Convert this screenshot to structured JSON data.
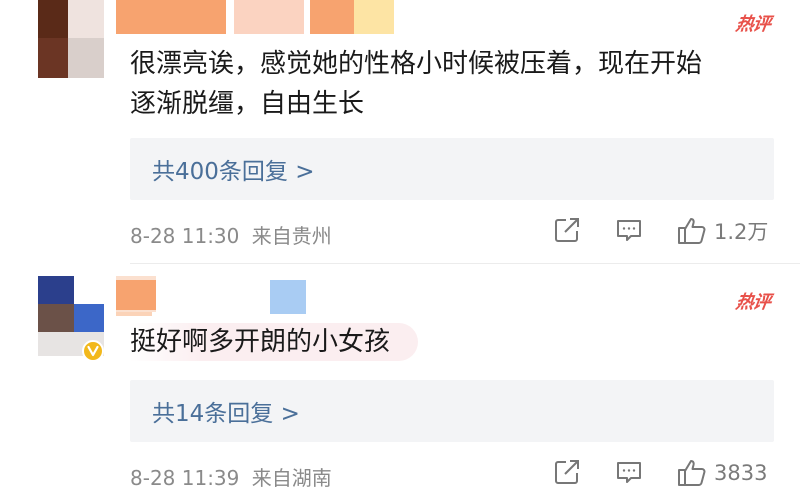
{
  "comments": [
    {
      "hot_label": "热评",
      "text_line1": "很漂亮诶，感觉她的性格小时候被压着，现在开始",
      "text_line2": "逐渐脱缰，自由生长",
      "replies_label": "共400条回复 >",
      "time": "8-28 11:30",
      "location": "来自贵州",
      "like_count": "1.2万"
    },
    {
      "hot_label": "热评",
      "text_line1": "挺好啊多开朗的小女孩",
      "replies_label": "共14条回复 >",
      "time": "8-28 11:39",
      "location": "来自湖南",
      "like_count": "3833"
    }
  ],
  "colors": {
    "hot": "#e8514a",
    "reply_link": "#4a6f99",
    "meta": "#8a8a8a",
    "reply_box_bg": "#f3f4f6"
  },
  "icons": [
    "share-icon",
    "comment-icon",
    "thumbs-up-icon",
    "verified-badge-icon"
  ]
}
